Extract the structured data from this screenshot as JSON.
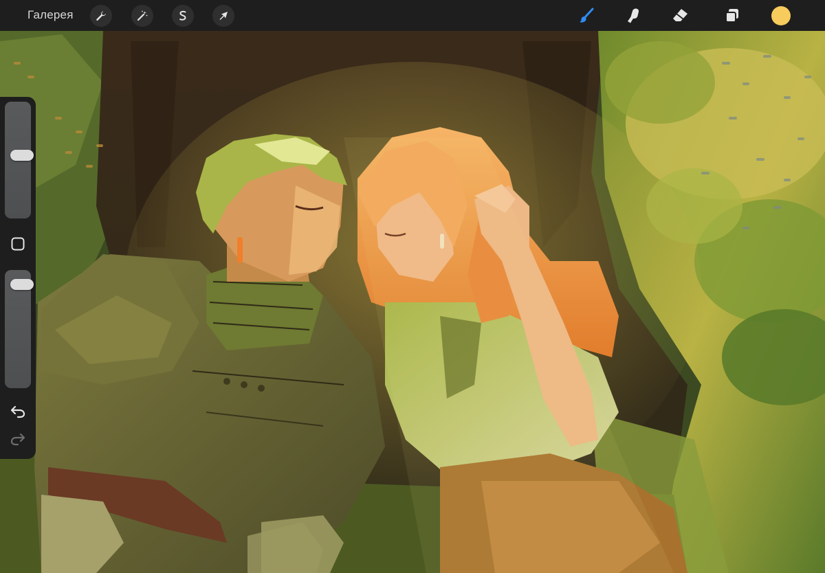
{
  "toolbar": {
    "gallery_label": "Галерея",
    "left_tools": [
      {
        "name": "actions",
        "icon": "wrench-icon"
      },
      {
        "name": "adjustments",
        "icon": "magic-wand-icon"
      },
      {
        "name": "selection",
        "icon": "selection-s-icon"
      },
      {
        "name": "transform",
        "icon": "arrow-cursor-icon"
      }
    ],
    "right_tools": [
      {
        "name": "brush",
        "icon": "brush-icon",
        "active": true
      },
      {
        "name": "smudge",
        "icon": "smudge-finger-icon",
        "active": false
      },
      {
        "name": "eraser",
        "icon": "eraser-icon",
        "active": false
      },
      {
        "name": "layers",
        "icon": "layers-icon",
        "active": false
      }
    ],
    "current_color": "#f7cb5c",
    "active_tool_color": "#2f8cf0"
  },
  "sidebar": {
    "brush_size_level": 0.55,
    "opacity_level": 0.94,
    "modify_icon": "square-icon",
    "undo_icon": "undo-arrow-icon",
    "redo_icon": "redo-arrow-icon"
  },
  "canvas": {
    "content": "painting"
  }
}
